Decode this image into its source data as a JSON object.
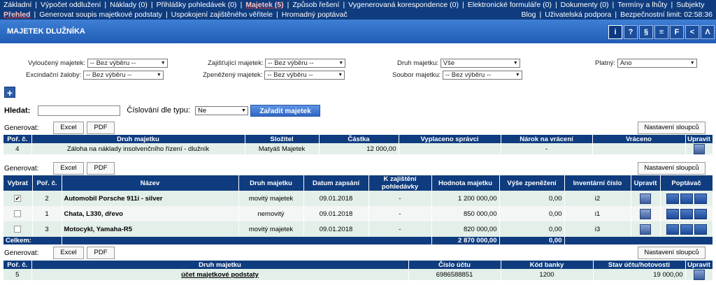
{
  "nav": {
    "row1": [
      "Základní",
      "Výpočet oddlužení",
      "Náklady (0)",
      "Přihlášky pohledávek (0)",
      "Majetek (5)",
      "Způsob řešení",
      "Vygenerovaná korespondence (0)",
      "Elektronické formuláře (0)",
      "Dokumenty (0)",
      "Termíny a lhůty",
      "Subjekty"
    ],
    "row2_left": [
      "Přehled",
      "Generovat soupis majetkové podstaty",
      "Uspokojení zajištěného věřitele",
      "Hromadný poptávač"
    ],
    "row2_right": [
      "Blog",
      "Uživatelská podpora",
      "Bezpečnostní limit: 02:58:36"
    ]
  },
  "header": {
    "title": "MAJETEK DLUŽNÍKA",
    "icons": [
      "i",
      "?",
      "§",
      "≡",
      "F",
      "<",
      "Λ"
    ]
  },
  "filters": {
    "vylouceny": {
      "label": "Vyloučený majetek:",
      "value": "-- Bez výběru --"
    },
    "excindacni": {
      "label": "Excindační žaloby:",
      "value": "-- Bez výběru --"
    },
    "zajistujici": {
      "label": "Zajišťující majetek:",
      "value": "-- Bez výběru --"
    },
    "zpenezeny": {
      "label": "Zpeněžený majetek:",
      "value": "-- Bez výběru --"
    },
    "druh": {
      "label": "Druh majetku:",
      "value": "Vše"
    },
    "soubor": {
      "label": "Soubor majetku:",
      "value": "-- Bez výběru --"
    },
    "platny": {
      "label": "Platný:",
      "value": "Ano"
    }
  },
  "search": {
    "label": "Hledat:",
    "value": "",
    "numbering_label": "Číslování dle typu:",
    "numbering_value": "Ne",
    "add_label": "Zařadit majetek"
  },
  "toolbar": {
    "generate": "Generovat:",
    "excel": "Excel",
    "pdf": "PDF",
    "columns": "Nastavení sloupců"
  },
  "table1": {
    "headers": [
      "Poř. č.",
      "Druh majetku",
      "Složitel",
      "Částka",
      "Vyplaceno správci",
      "Nárok na vrácení",
      "Vráceno",
      "Upravit"
    ],
    "rows": [
      [
        "4",
        "Záloha na náklady insolvenčního řízení - dlužník",
        "Matyáš Majetek",
        "12 000,00",
        "",
        "-",
        "",
        ""
      ]
    ]
  },
  "table2": {
    "headers": [
      "Vybrat",
      "Poř. č.",
      "Název",
      "Druh majetku",
      "Datum zapsání",
      "K zajištění pohledávky",
      "Hodnota majetku",
      "Výše zpeněžení",
      "Inventární číslo",
      "Upravit",
      "Poptávač"
    ],
    "rows": [
      {
        "checked": "✔",
        "no": "2",
        "name": "Automobil Porsche 911i - silver",
        "type": "movitý majetek",
        "date": "09.01.2018",
        "secured": "-",
        "value": "1 200 000,00",
        "sold": "0,00",
        "inv": "i2"
      },
      {
        "checked": "",
        "no": "1",
        "name": "Chata, L330, dřevo",
        "type": "nemovitý",
        "date": "09.01.2018",
        "secured": "-",
        "value": "850 000,00",
        "sold": "0,00",
        "inv": "i1"
      },
      {
        "checked": "",
        "no": "3",
        "name": "Motocykl, Yamaha-R5",
        "type": "movitý majetek",
        "date": "09.01.2018",
        "secured": "-",
        "value": "820 000,00",
        "sold": "0,00",
        "inv": "i3"
      }
    ],
    "total_label": "Celkem:",
    "total_value": "2 870 000,00",
    "total_sold": "0,00"
  },
  "table3": {
    "headers": [
      "Poř. č.",
      "Druh majetku",
      "Číslo účtu",
      "Kód banky",
      "Stav účtu/hotovosti",
      "Upravit"
    ],
    "rows": [
      [
        "5",
        "účet majetkové podstaty",
        "6986588851",
        "1200",
        "19 000,00",
        ""
      ]
    ]
  }
}
